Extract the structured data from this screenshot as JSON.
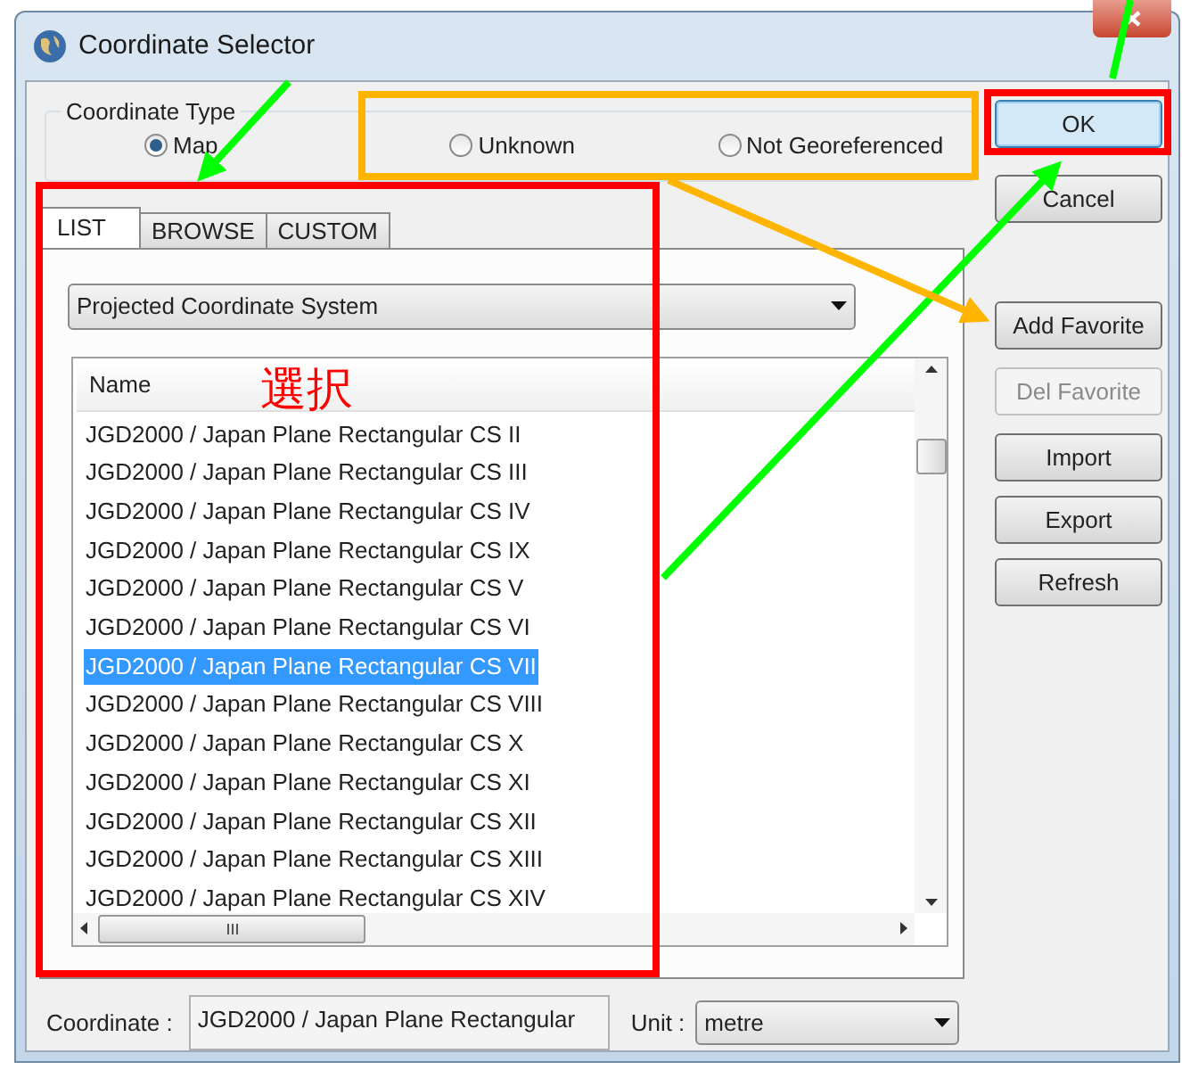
{
  "window": {
    "title": "Coordinate Selector"
  },
  "coordinate_type": {
    "label": "Coordinate Type",
    "options": [
      {
        "label": "Map",
        "selected": true
      },
      {
        "label": "Unknown",
        "selected": false
      },
      {
        "label": "Not Georeferenced",
        "selected": false
      }
    ]
  },
  "tabs": [
    {
      "label": "LIST",
      "selected": true
    },
    {
      "label": "BROWSE",
      "selected": false
    },
    {
      "label": "CUSTOM",
      "selected": false
    }
  ],
  "system_dropdown": {
    "value": "Projected Coordinate System"
  },
  "list": {
    "column": "Name",
    "rows": [
      {
        "name": "JGD2000 / Japan Plane Rectangular CS II",
        "selected": false
      },
      {
        "name": "JGD2000 / Japan Plane Rectangular CS III",
        "selected": false
      },
      {
        "name": "JGD2000 / Japan Plane Rectangular CS IV",
        "selected": false
      },
      {
        "name": "JGD2000 / Japan Plane Rectangular CS IX",
        "selected": false
      },
      {
        "name": "JGD2000 / Japan Plane Rectangular CS V",
        "selected": false
      },
      {
        "name": "JGD2000 / Japan Plane Rectangular CS VI",
        "selected": false
      },
      {
        "name": "JGD2000 / Japan Plane Rectangular CS VII",
        "selected": true
      },
      {
        "name": "JGD2000 / Japan Plane Rectangular CS VIII",
        "selected": false
      },
      {
        "name": "JGD2000 / Japan Plane Rectangular CS X",
        "selected": false
      },
      {
        "name": "JGD2000 / Japan Plane Rectangular CS XI",
        "selected": false
      },
      {
        "name": "JGD2000 / Japan Plane Rectangular CS XII",
        "selected": false
      },
      {
        "name": "JGD2000 / Japan Plane Rectangular CS XIII",
        "selected": false
      },
      {
        "name": "JGD2000 / Japan Plane Rectangular CS XIV",
        "selected": false
      }
    ]
  },
  "buttons": [
    {
      "label": "OK",
      "disabled": false,
      "default": true
    },
    {
      "label": "Cancel",
      "disabled": false,
      "default": false
    },
    {
      "label": "Add Favorite",
      "disabled": false,
      "default": false
    },
    {
      "label": "Del Favorite",
      "disabled": true,
      "default": false
    },
    {
      "label": "Import",
      "disabled": false,
      "default": false
    },
    {
      "label": "Export",
      "disabled": false,
      "default": false
    },
    {
      "label": "Refresh",
      "disabled": false,
      "default": false
    }
  ],
  "coordinate": {
    "label": "Coordinate :",
    "value": "JGD2000 / Japan Plane Rectangular"
  },
  "unit": {
    "label": "Unit :",
    "value": "metre"
  },
  "annotation": {
    "label": "選択"
  }
}
